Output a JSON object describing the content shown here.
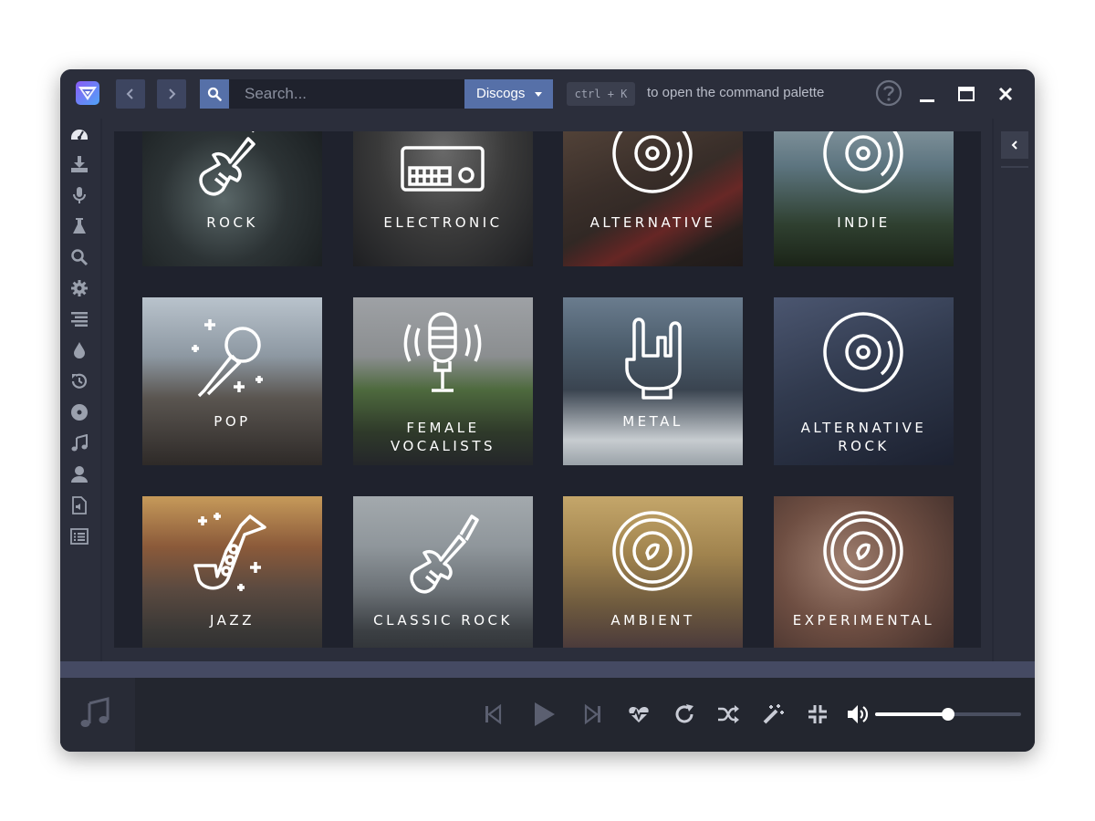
{
  "colors": {
    "window_bg": "#2b2e3b",
    "content_bg": "#1f222d",
    "accent": "#5670a8",
    "progress_strip": "#454a63",
    "player_bg": "#23262f"
  },
  "titlebar": {
    "app_icon": "nuclear-logo-icon",
    "back_icon": "chevron-left-icon",
    "forward_icon": "chevron-right-icon",
    "search_icon": "search-icon",
    "search_placeholder": "Search...",
    "search_value": "",
    "source_selected": "Discogs",
    "shortcut": "ctrl + K",
    "shortcut_hint": "to open the command palette",
    "help_icon": "help-circle-icon",
    "minimize_icon": "minimize-icon",
    "maximize_icon": "maximize-icon",
    "close_icon": "close-icon"
  },
  "sidebar": {
    "items": [
      {
        "name": "dashboard",
        "icon": "dashboard-icon"
      },
      {
        "name": "downloads",
        "icon": "download-icon"
      },
      {
        "name": "lyrics",
        "icon": "microphone-icon"
      },
      {
        "name": "plugins",
        "icon": "flask-icon"
      },
      {
        "name": "search-results",
        "icon": "search-icon"
      },
      {
        "name": "settings",
        "icon": "gear-icon"
      },
      {
        "name": "equalizer",
        "icon": "align-right-icon"
      },
      {
        "name": "visualizer",
        "icon": "drop-icon"
      },
      {
        "name": "history",
        "icon": "history-icon"
      },
      {
        "name": "library",
        "icon": "disc-icon"
      },
      {
        "name": "playlists",
        "icon": "music-icon"
      },
      {
        "name": "user",
        "icon": "user-icon"
      },
      {
        "name": "local-files",
        "icon": "audio-file-icon"
      },
      {
        "name": "queue",
        "icon": "list-icon"
      }
    ]
  },
  "genres": [
    {
      "id": "rock",
      "lines": [
        "ROCK",
        ""
      ],
      "icon": "electric-guitar-icon"
    },
    {
      "id": "electronic",
      "lines": [
        "ELECTRONIC",
        ""
      ],
      "icon": "synthesizer-icon"
    },
    {
      "id": "alternative",
      "lines": [
        "ALTERNATIVE",
        ""
      ],
      "icon": "vinyl-record-icon"
    },
    {
      "id": "indie",
      "lines": [
        "INDIE",
        ""
      ],
      "icon": "vinyl-record-icon"
    },
    {
      "id": "pop",
      "lines": [
        "POP",
        ""
      ],
      "icon": "microphone-sparkle-icon"
    },
    {
      "id": "female-vocalists",
      "lines": [
        "FEMALE",
        "VOCALISTS"
      ],
      "icon": "studio-microphone-icon"
    },
    {
      "id": "metal",
      "lines": [
        "METAL",
        ""
      ],
      "icon": "rock-hand-icon"
    },
    {
      "id": "alternative-rock",
      "lines": [
        "ALTERNATIVE",
        "ROCK"
      ],
      "icon": "vinyl-record-icon"
    },
    {
      "id": "jazz",
      "lines": [
        "JAZZ",
        ""
      ],
      "icon": "saxophone-icon"
    },
    {
      "id": "classic-rock",
      "lines": [
        "CLASSIC ROCK",
        ""
      ],
      "icon": "electric-guitar-icon"
    },
    {
      "id": "ambient",
      "lines": [
        "AMBIENT",
        ""
      ],
      "icon": "speaker-icon"
    },
    {
      "id": "experimental",
      "lines": [
        "EXPERIMENTAL",
        ""
      ],
      "icon": "speaker-icon"
    }
  ],
  "right_panel": {
    "toggle_icon": "chevron-left-icon"
  },
  "player": {
    "cover_icon": "music-note-icon",
    "controls": [
      {
        "name": "previous",
        "icon": "skip-back-icon"
      },
      {
        "name": "play",
        "icon": "play-icon"
      },
      {
        "name": "next",
        "icon": "skip-forward-icon"
      },
      {
        "name": "favorite",
        "icon": "heartbeat-icon"
      },
      {
        "name": "repeat",
        "icon": "repeat-icon"
      },
      {
        "name": "shuffle",
        "icon": "shuffle-icon"
      },
      {
        "name": "autoradio",
        "icon": "magic-wand-icon"
      },
      {
        "name": "mini-player",
        "icon": "compress-icon"
      },
      {
        "name": "volume",
        "icon": "volume-icon"
      }
    ],
    "volume": 0.5
  }
}
